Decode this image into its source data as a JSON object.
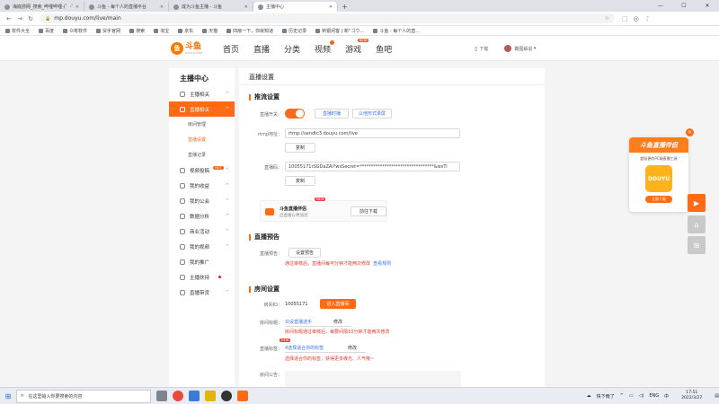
{
  "browser": {
    "tabs": [
      {
        "label": "海底捞网_搜索_哔哩哔哩-(゜-゜)つロ",
        "active": false
      },
      {
        "label": "斗鱼 - 每个人的直播平台",
        "active": false
      },
      {
        "label": "成为斗鱼主播 - 斗鱼",
        "active": false
      },
      {
        "label": "主播中心",
        "active": true
      }
    ],
    "new_tab": "+",
    "url": "mp.douyu.com/live/main",
    "bookmarks": [
      "软件大全",
      "百度",
      "众筹软件",
      "贸手官网",
      "搜索",
      "淘宝",
      "京东",
      "天猫",
      "四扇一下，你就知道",
      "历史记录",
      "新银闲客 | 新\"ゴウ…",
      "斗鱼 - 每个人的直..."
    ]
  },
  "header": {
    "logo_text": "斗鱼",
    "logo_sub": "DOUYU.COM",
    "nav": [
      {
        "label": "首页",
        "badge": ""
      },
      {
        "label": "直播",
        "badge": ""
      },
      {
        "label": "分类",
        "badge": ""
      },
      {
        "label": "视频",
        "badge": "dot"
      },
      {
        "label": "游戏",
        "badge": "NEW"
      },
      {
        "label": "鱼吧",
        "badge": ""
      }
    ],
    "download": "下载",
    "username": "霸图解说"
  },
  "sidebar": {
    "title": "主播中心",
    "items": [
      {
        "label": "主播相关",
        "chevron": "^",
        "type": "item"
      },
      {
        "label": "直播相关",
        "chevron": "^",
        "type": "active"
      },
      {
        "label": "房间管理",
        "type": "sub"
      },
      {
        "label": "直播设置",
        "type": "sub-selected"
      },
      {
        "label": "直播记录",
        "type": "sub"
      },
      {
        "label": "视频投稿",
        "chevron": "^",
        "type": "item",
        "hot": "HOT"
      },
      {
        "label": "我的收益",
        "chevron": "^",
        "type": "item"
      },
      {
        "label": "我的公会",
        "chevron": "^",
        "type": "item"
      },
      {
        "label": "数据分析",
        "chevron": "^",
        "type": "item"
      },
      {
        "label": "商业活动",
        "chevron": "^",
        "type": "item"
      },
      {
        "label": "我的视频",
        "chevron": "^",
        "type": "item"
      },
      {
        "label": "我的推广",
        "chevron": "",
        "type": "item"
      },
      {
        "label": "主播扶持",
        "chevron": "",
        "type": "item",
        "dot": true
      },
      {
        "label": "直播带货",
        "chevron": "^",
        "type": "item"
      }
    ]
  },
  "content": {
    "page_title": "直播设置",
    "stream": {
      "section": "推流设置",
      "switch_label": "直播开关：",
      "switch_on": true,
      "btn_live_record": "直播时播",
      "btn_recording": "以他形式录屏",
      "rtmp_label": "rtmp地址：",
      "rtmp_value": "rtmp://sendtc3.douyu.com/live",
      "copy1": "复制",
      "code_label": "直播码：",
      "code_value": "10055171rSGDaZAl?wsSecret=*********************************&wsTi",
      "copy2": "复制",
      "promo_title": "斗鱼直播伴侣",
      "promo_sub": "启直播以更加流",
      "promo_new": "NEW",
      "promo_btn": "前往下载"
    },
    "preview": {
      "section": "直播预告",
      "label": "直播预告：",
      "btn": "设置预告",
      "note": "通过审核后，直播间每可分钟才能两次修改",
      "note_link": "查看规则"
    },
    "room": {
      "section": "房间设置",
      "id_label": "房间ID：",
      "id_value": "10055171",
      "enter_btn": "进入直播间",
      "title_label": "房间标题：",
      "title_value": "识设直播选手",
      "title_edit": "修改",
      "title_note": "房间标题通过审核后，每要间隔10分钟才能两次修改",
      "tag_label": "直播标签：",
      "tag_new": "NEW",
      "tag_value": "4选择适合你的标签",
      "tag_edit": "修改",
      "tag_note": "选择适合你的标签，获得更多曝光、人气哦~",
      "notice_label": "房间公告："
    }
  },
  "ad": {
    "title": "斗鱼直播伴侣",
    "sub": "超轻便的PC端直播工具",
    "img_text": "DOUYU",
    "btn": "立即下载",
    "close": "×"
  },
  "taskbar": {
    "search_placeholder": "在这里输入你要搜索的内容",
    "weather": "快下雨了",
    "lang": "ENG",
    "time": "17:51",
    "date": "2022/3/27"
  },
  "colors": {
    "accent": "#ff6a15",
    "link": "#3b72e8",
    "warning": "#e33b2e"
  }
}
